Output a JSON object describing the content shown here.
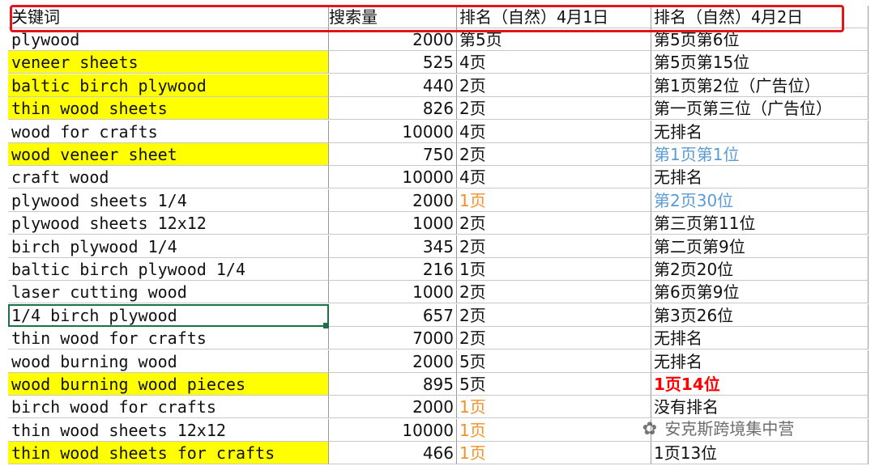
{
  "header": {
    "keyword": "关键词",
    "volume": "搜索量",
    "rank_apr1": "排名（自然）4月1日",
    "rank_apr2": "排名（自然）4月2日"
  },
  "rows": [
    {
      "keyword": "plywood",
      "volume": "2000",
      "rank_apr1": "第5页",
      "rank_apr2": "第5页第6位",
      "highlight": false
    },
    {
      "keyword": "veneer sheets",
      "volume": "525",
      "rank_apr1": "4页",
      "rank_apr2": "第5页第15位",
      "highlight": true
    },
    {
      "keyword": "baltic birch plywood",
      "volume": "440",
      "rank_apr1": "2页",
      "rank_apr2": "第1页第2位（广告位）",
      "highlight": true
    },
    {
      "keyword": "thin wood sheets",
      "volume": "826",
      "rank_apr1": "2页",
      "rank_apr2": "第一页第三位（广告位）",
      "highlight": true
    },
    {
      "keyword": "wood for crafts",
      "volume": "10000",
      "rank_apr1": "4页",
      "rank_apr2": "无排名",
      "highlight": false
    },
    {
      "keyword": "wood veneer sheet",
      "volume": "750",
      "rank_apr1": "2页",
      "rank_apr2": "第1页第1位",
      "highlight": true,
      "rank_apr2_color": "blue"
    },
    {
      "keyword": "craft wood",
      "volume": "10000",
      "rank_apr1": "4页",
      "rank_apr2": "无排名",
      "highlight": false
    },
    {
      "keyword": "plywood sheets 1/4",
      "volume": "2000",
      "rank_apr1": "1页",
      "rank_apr2": "第2页30位",
      "highlight": false,
      "rank_apr1_color": "orange",
      "rank_apr2_color": "blue"
    },
    {
      "keyword": "plywood sheets 12x12",
      "volume": "1000",
      "rank_apr1": "2页",
      "rank_apr2": "第三页第11位",
      "highlight": false
    },
    {
      "keyword": "birch plywood 1/4",
      "volume": "345",
      "rank_apr1": "2页",
      "rank_apr2": "第二页第9位",
      "highlight": false
    },
    {
      "keyword": "baltic birch plywood 1/4",
      "volume": "216",
      "rank_apr1": "1页",
      "rank_apr2": "第2页20位",
      "highlight": false
    },
    {
      "keyword": "laser cutting wood",
      "volume": "1000",
      "rank_apr1": "2页",
      "rank_apr2": "第6页第9位",
      "highlight": false
    },
    {
      "keyword": "1/4 birch plywood",
      "volume": "657",
      "rank_apr1": "2页",
      "rank_apr2": "第3页26位",
      "highlight": false,
      "selected": true
    },
    {
      "keyword": "thin wood for crafts",
      "volume": "7000",
      "rank_apr1": "2页",
      "rank_apr2": "无排名",
      "highlight": false
    },
    {
      "keyword": "wood burning wood",
      "volume": "2000",
      "rank_apr1": "5页",
      "rank_apr2": "无排名",
      "highlight": false
    },
    {
      "keyword": "wood burning wood pieces",
      "volume": "895",
      "rank_apr1": "5页",
      "rank_apr2": "1页14位",
      "highlight": true,
      "rank_apr2_color": "red"
    },
    {
      "keyword": "birch wood for crafts",
      "volume": "2000",
      "rank_apr1": "1页",
      "rank_apr2": "没有排名",
      "highlight": false,
      "rank_apr1_color": "orange"
    },
    {
      "keyword": "thin wood sheets 12x12",
      "volume": "10000",
      "rank_apr1": "1页",
      "rank_apr2": "",
      "highlight": false,
      "rank_apr1_color": "orange"
    },
    {
      "keyword": "thin wood sheets for crafts",
      "volume": "466",
      "rank_apr1": "1页",
      "rank_apr2": "1页13位",
      "highlight": true,
      "rank_apr1_color": "orange"
    }
  ],
  "watermark": {
    "icon": "wechat-icon",
    "text": "安克斯跨境集中营"
  },
  "colors": {
    "highlight": "#ffff00",
    "annotation_box": "#e0161b",
    "orange": "#f6902a",
    "blue": "#5b9bd5",
    "red": "#ff0000",
    "selection": "#1e7145"
  }
}
